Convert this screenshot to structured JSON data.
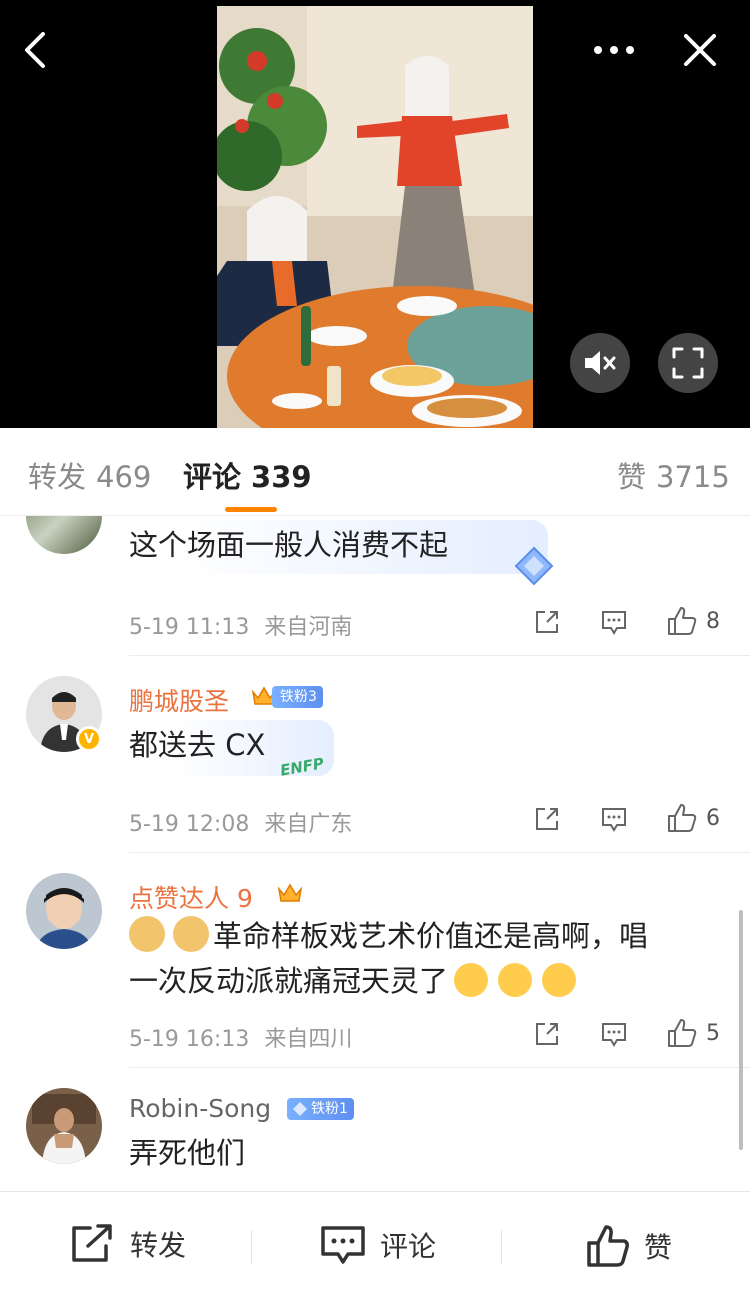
{
  "video": {
    "back_icon": "chevron-left-icon",
    "more_icon": "more-dots-icon",
    "close_icon": "close-icon",
    "mute_icon": "mute-icon",
    "fullscreen_icon": "fullscreen-icon"
  },
  "tabs": [
    {
      "label": "转发",
      "count": "469"
    },
    {
      "label": "评论",
      "count": "339"
    },
    {
      "label": "赞",
      "count": "3715"
    }
  ],
  "accent_color": "#ff8200",
  "comments": [
    {
      "text": "这个场面一般人消费不起",
      "time": "5-19 11:13",
      "location": "来自河南",
      "likes": "8"
    },
    {
      "name": "鹏城股圣",
      "badge": "铁粉3",
      "text": "都送去 CX",
      "time": "5-19 12:08",
      "location": "来自广东",
      "likes": "6",
      "sticker_text": "ENFP"
    },
    {
      "name": "点赞达人 9",
      "text_line1": "革命样板戏艺术价值还是高啊，唱",
      "text_line2": "一次反动派就痛冠天灵了",
      "time": "5-19 16:13",
      "location": "来自四川",
      "likes": "5"
    },
    {
      "name": "Robin-Song",
      "badge": "铁粉1",
      "text": "弄死他们"
    }
  ],
  "bottom_bar": {
    "repost": "转发",
    "comment": "评论",
    "like": "赞"
  }
}
